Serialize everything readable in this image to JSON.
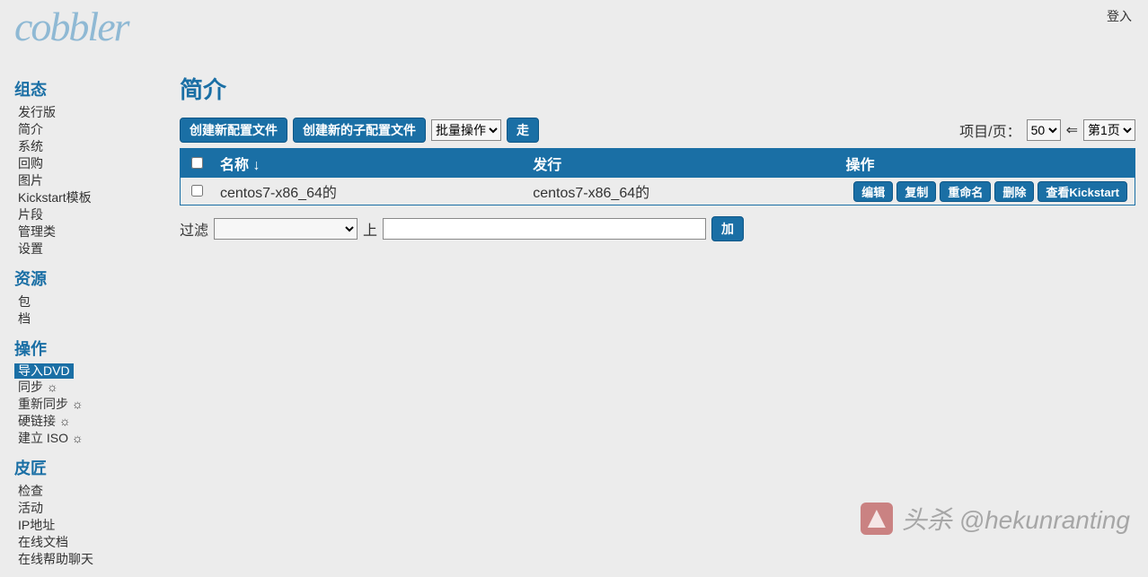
{
  "logo_text": "cobbler",
  "login_label": "登入",
  "sidebar": [
    {
      "header": "组态",
      "items": [
        {
          "label": "发行版"
        },
        {
          "label": "简介"
        },
        {
          "label": "系统"
        },
        {
          "label": "回购"
        },
        {
          "label": "图片"
        },
        {
          "label": "Kickstart模板"
        },
        {
          "label": "片段"
        },
        {
          "label": "管理类"
        },
        {
          "label": "设置"
        }
      ]
    },
    {
      "header": "资源",
      "items": [
        {
          "label": "包"
        },
        {
          "label": "档"
        }
      ]
    },
    {
      "header": "操作",
      "items": [
        {
          "label": "导入DVD",
          "selected": true
        },
        {
          "label": "同步 ☼"
        },
        {
          "label": "重新同步 ☼"
        },
        {
          "label": "硬链接 ☼"
        },
        {
          "label": "建立 ISO ☼"
        }
      ]
    },
    {
      "header": "皮匠",
      "items": [
        {
          "label": "检查"
        },
        {
          "label": "活动"
        },
        {
          "label": "IP地址"
        },
        {
          "label": "在线文档"
        },
        {
          "label": "在线帮助聊天"
        }
      ]
    }
  ],
  "page_title": "简介",
  "toolbar": {
    "create_new": "创建新配置文件",
    "create_sub": "创建新的子配置文件",
    "batch_label": "批量操作",
    "go": "走"
  },
  "pager": {
    "items_per_page_label": "项目/页：",
    "items_per_page": "50",
    "arrow_left": "⇐",
    "page_label": "第1页",
    "arrow_right": ""
  },
  "table": {
    "headers": {
      "name": "名称 ↓",
      "release": "发行",
      "actions": "操作"
    },
    "rows": [
      {
        "name": "centos7-x86_64的",
        "release": "centos7-x86_64的"
      }
    ],
    "row_actions": {
      "edit": "编辑",
      "copy": "复制",
      "rename": "重命名",
      "delete": "删除",
      "view_ks": "查看Kickstart"
    }
  },
  "filter": {
    "label": "过滤",
    "up_label": "上",
    "add": "加"
  },
  "watermark": "头杀 @hekunranting"
}
